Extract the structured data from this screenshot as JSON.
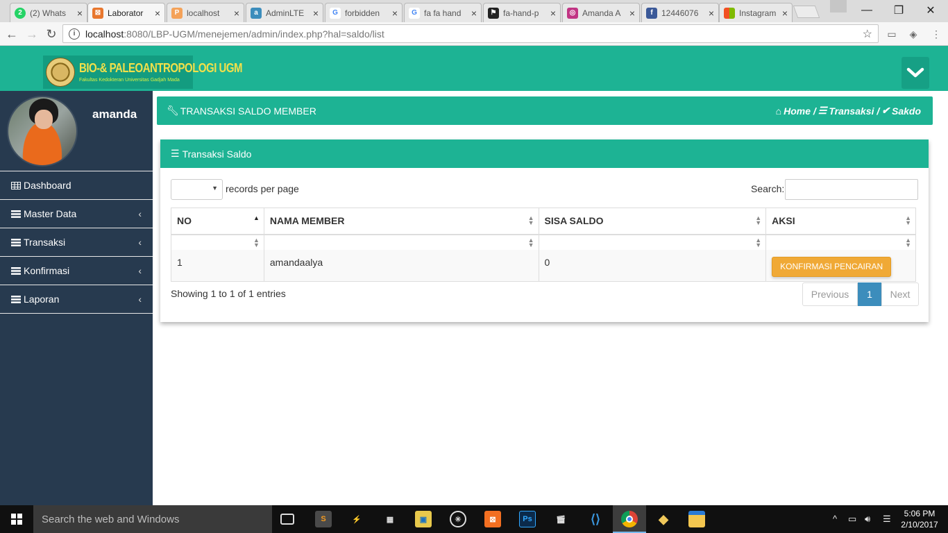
{
  "browser": {
    "tabs": [
      {
        "title": "(2) Whats",
        "favicon_color": "#25d366",
        "favicon_glyph": "2",
        "icon": "whatsapp-icon"
      },
      {
        "title": "Laborator",
        "favicon_color": "#e8772e",
        "favicon_glyph": "⊠",
        "icon": "xampp-icon",
        "active": true
      },
      {
        "title": "localhost",
        "favicon_color": "#f4a259",
        "favicon_glyph": "P",
        "icon": "phpmyadmin-icon"
      },
      {
        "title": "AdminLTE",
        "favicon_color": "#3c8dbc",
        "favicon_glyph": "a",
        "icon": "adminlte-icon"
      },
      {
        "title": "forbidden",
        "favicon_color": "#4285f4",
        "favicon_glyph": "G",
        "icon": "google-icon"
      },
      {
        "title": "fa fa hand",
        "favicon_color": "#4285f4",
        "favicon_glyph": "G",
        "icon": "google-icon"
      },
      {
        "title": "fa-hand-p",
        "favicon_color": "#222222",
        "favicon_glyph": "⚑",
        "icon": "fontawesome-flag-icon"
      },
      {
        "title": "Amanda A",
        "favicon_color": "#c13584",
        "favicon_glyph": "◎",
        "icon": "instagram-icon"
      },
      {
        "title": "12446076",
        "favicon_color": "#3b5998",
        "favicon_glyph": "f",
        "icon": "facebook-icon"
      },
      {
        "title": "Instagram",
        "favicon_color": "#f25022",
        "favicon_glyph": "■",
        "icon": "microsoft-icon"
      }
    ],
    "url_host": "localhost",
    "url_path": ":8080/LBP-UGM/menejemen/admin/index.php?hal=saldo/list"
  },
  "header": {
    "logo_title": "BIO-& PALEOANTROPOLOGI UGM",
    "logo_subtitle": "Fakultas Kedokteran Universitas Gadjah Mada",
    "brand_color": "#1db394"
  },
  "sidebar": {
    "user_name": "amanda",
    "items": [
      {
        "label": "Dashboard",
        "icon": "table-icon",
        "has_caret": false
      },
      {
        "label": "Master Data",
        "icon": "list-icon",
        "has_caret": true
      },
      {
        "label": "Transaksi",
        "icon": "list-icon",
        "has_caret": true
      },
      {
        "label": "Konfirmasi",
        "icon": "list-icon",
        "has_caret": true
      },
      {
        "label": "Laporan",
        "icon": "list-icon",
        "has_caret": true
      }
    ]
  },
  "page": {
    "title": "TRANSAKSI SALDO MEMBER",
    "breadcrumb": {
      "home": "Home /",
      "section": "Transaksi /",
      "current": "Sakdo"
    }
  },
  "box": {
    "title": "Transaksi Saldo",
    "length_label": "records per page",
    "search_label": "Search:",
    "columns": [
      "NO",
      "NAMA MEMBER",
      "SISA SALDO",
      "AKSI"
    ],
    "rows": [
      {
        "no": "1",
        "nama": "amandaalya",
        "saldo": "0",
        "aksi": "KONFIRMASI PENCAIRAN"
      }
    ],
    "info": "Showing 1 to 1 of 1 entries",
    "pagination": {
      "prev": "Previous",
      "current": "1",
      "next": "Next"
    }
  },
  "taskbar": {
    "search_placeholder": "Search the web and Windows",
    "time": "5:06 PM",
    "date": "2/10/2017"
  }
}
